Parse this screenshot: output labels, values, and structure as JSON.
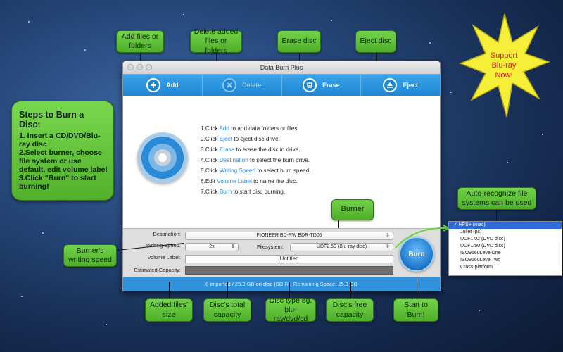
{
  "window": {
    "title": "Data Burn Plus",
    "toolbar": [
      {
        "label": "Add",
        "icon": "plus-circle-icon",
        "enabled": true
      },
      {
        "label": "Delete",
        "icon": "x-circle-icon",
        "enabled": false
      },
      {
        "label": "Erase",
        "icon": "eraser-icon",
        "enabled": true
      },
      {
        "label": "Eject",
        "icon": "eject-icon",
        "enabled": true
      }
    ],
    "instructions": [
      {
        "pre": "1.Click ",
        "link": "Add",
        "post": " to add data folders or files."
      },
      {
        "pre": "2.Click ",
        "link": "Eject",
        "post": " to eject disc drive."
      },
      {
        "pre": "3.Click ",
        "link": "Erase",
        "post": " to erase the disc in drive."
      },
      {
        "pre": "4.Click ",
        "link": "Destination",
        "post": " to select the burn drive."
      },
      {
        "pre": "5.Click ",
        "link": "Writing Speed",
        "post": " to select burn speed."
      },
      {
        "pre": "6.Edit ",
        "link": "Volume Label",
        "post": " to name the disc."
      },
      {
        "pre": "7.Click ",
        "link": "Burn",
        "post": " to start disc burning."
      }
    ],
    "destination_label": "Destination:",
    "destination_value": "PIONEER BD-RW BDR-TD05",
    "writing_speed_label": "Writing Speed:",
    "writing_speed_value": "2x",
    "filesystem_label": "Filesystem:",
    "filesystem_value": "UDF2.50 (Blu-ray disc)",
    "volume_label_label": "Volume Label:",
    "volume_label_value": "Untitled",
    "estimated_capacity_label": "Estimated Capacity:",
    "burn_label": "Burn",
    "status": "0 imported / 25.3 GB on disc (BD-R). Remaining Space: 25.3 GB"
  },
  "filesystem_options": [
    {
      "label": "HFS+ (mac)",
      "selected": true
    },
    {
      "label": "Joliet (pc)",
      "selected": false
    },
    {
      "label": "UDF1.02 (DVD disc)",
      "selected": false
    },
    {
      "label": "UDF1.50 (DVD disc)",
      "selected": false
    },
    {
      "label": "ISO9660LevelOne",
      "selected": false
    },
    {
      "label": "ISO9660LevelTwo",
      "selected": false
    },
    {
      "label": "Cross-platform",
      "selected": false
    }
  ],
  "callouts": {
    "add": "Add files or folders",
    "delete": "Delete added files or folders",
    "erase": "Erase disc",
    "eject": "Eject disc",
    "burner": "Burner",
    "auto_recognize": "Auto-recognize file systems can be used",
    "writing_speed": "Burner's writing speed",
    "added_size": "Added files' size",
    "total_capacity": "Disc's total capacity",
    "disc_type": "Disc type eg. blu-ray/dvd/cd",
    "free_capacity": "Disc's free capacity",
    "start_burn": "Start to Burn!"
  },
  "steps": {
    "title": "Steps to Burn a Disc:",
    "body": "1. Insert a CD/DVD/Blu-ray disc\n2.Select burner, choose file system or use default, edit volume label\n3.Click \"Burn\" to start burning!"
  },
  "promo": {
    "line1": "Support",
    "line2": "Blu-ray",
    "line3": "Now!"
  },
  "colors": {
    "toolbar": "#2593e0",
    "callout": "#5fbf34",
    "burst": "#f5ef3a",
    "promo_text": "#d11b1b"
  }
}
